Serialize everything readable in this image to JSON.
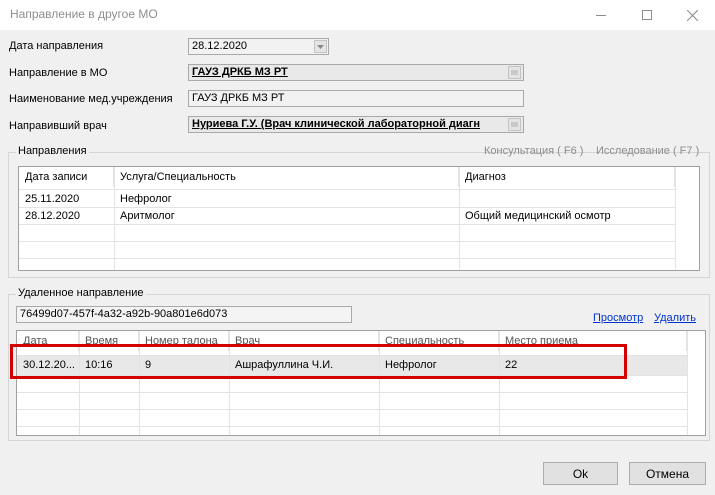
{
  "window": {
    "title": "Направление в другое МО",
    "minimize": "—",
    "maximize": "☐",
    "close": "✕"
  },
  "form": {
    "date_label": "Дата направления",
    "date_value": "28.12.2020",
    "mo_label": "Направление в МО",
    "mo_value": "ГАУЗ ДРКБ МЗ РТ",
    "institution_label": "Наименование мед.учреждения",
    "institution_value": "ГАУЗ ДРКБ МЗ РТ",
    "doctor_label": "Направивший врач",
    "doctor_value": "Нуриева Г.У. (Врач клинической лабораторной диагн"
  },
  "directions": {
    "group_title": "Направления",
    "tab_consult": "Консультация ( F6 )",
    "tab_research": "Исследование ( F7 )",
    "columns": [
      "Дата записи",
      "Услуга/Специальность",
      "Диагноз"
    ],
    "rows": [
      {
        "date": "25.11.2020",
        "service": "Нефролог",
        "diagnosis": ""
      },
      {
        "date": "28.12.2020",
        "service": "Аритмолог",
        "diagnosis": "Общий медицинский осмотр"
      }
    ]
  },
  "remote": {
    "group_title": "Удаленное направление",
    "guid": "76499d07-457f-4a32-a92b-90a801e6d073",
    "view_link": "Просмотр",
    "delete_link": "Удалить",
    "columns": [
      "Дата",
      "Время",
      "Номер талона",
      "Врач",
      "Специальность",
      "Место приема"
    ],
    "row": {
      "date": "30.12.20...",
      "time": "10:16",
      "ticket": "9",
      "doctor": "Ашрафуллина Ч.И.",
      "specialty": "Нефролог",
      "place": "22"
    }
  },
  "buttons": {
    "ok": "Ok",
    "cancel": "Отмена"
  },
  "colors": {
    "highlight_border": "#d40000",
    "link": "#0033cc"
  }
}
